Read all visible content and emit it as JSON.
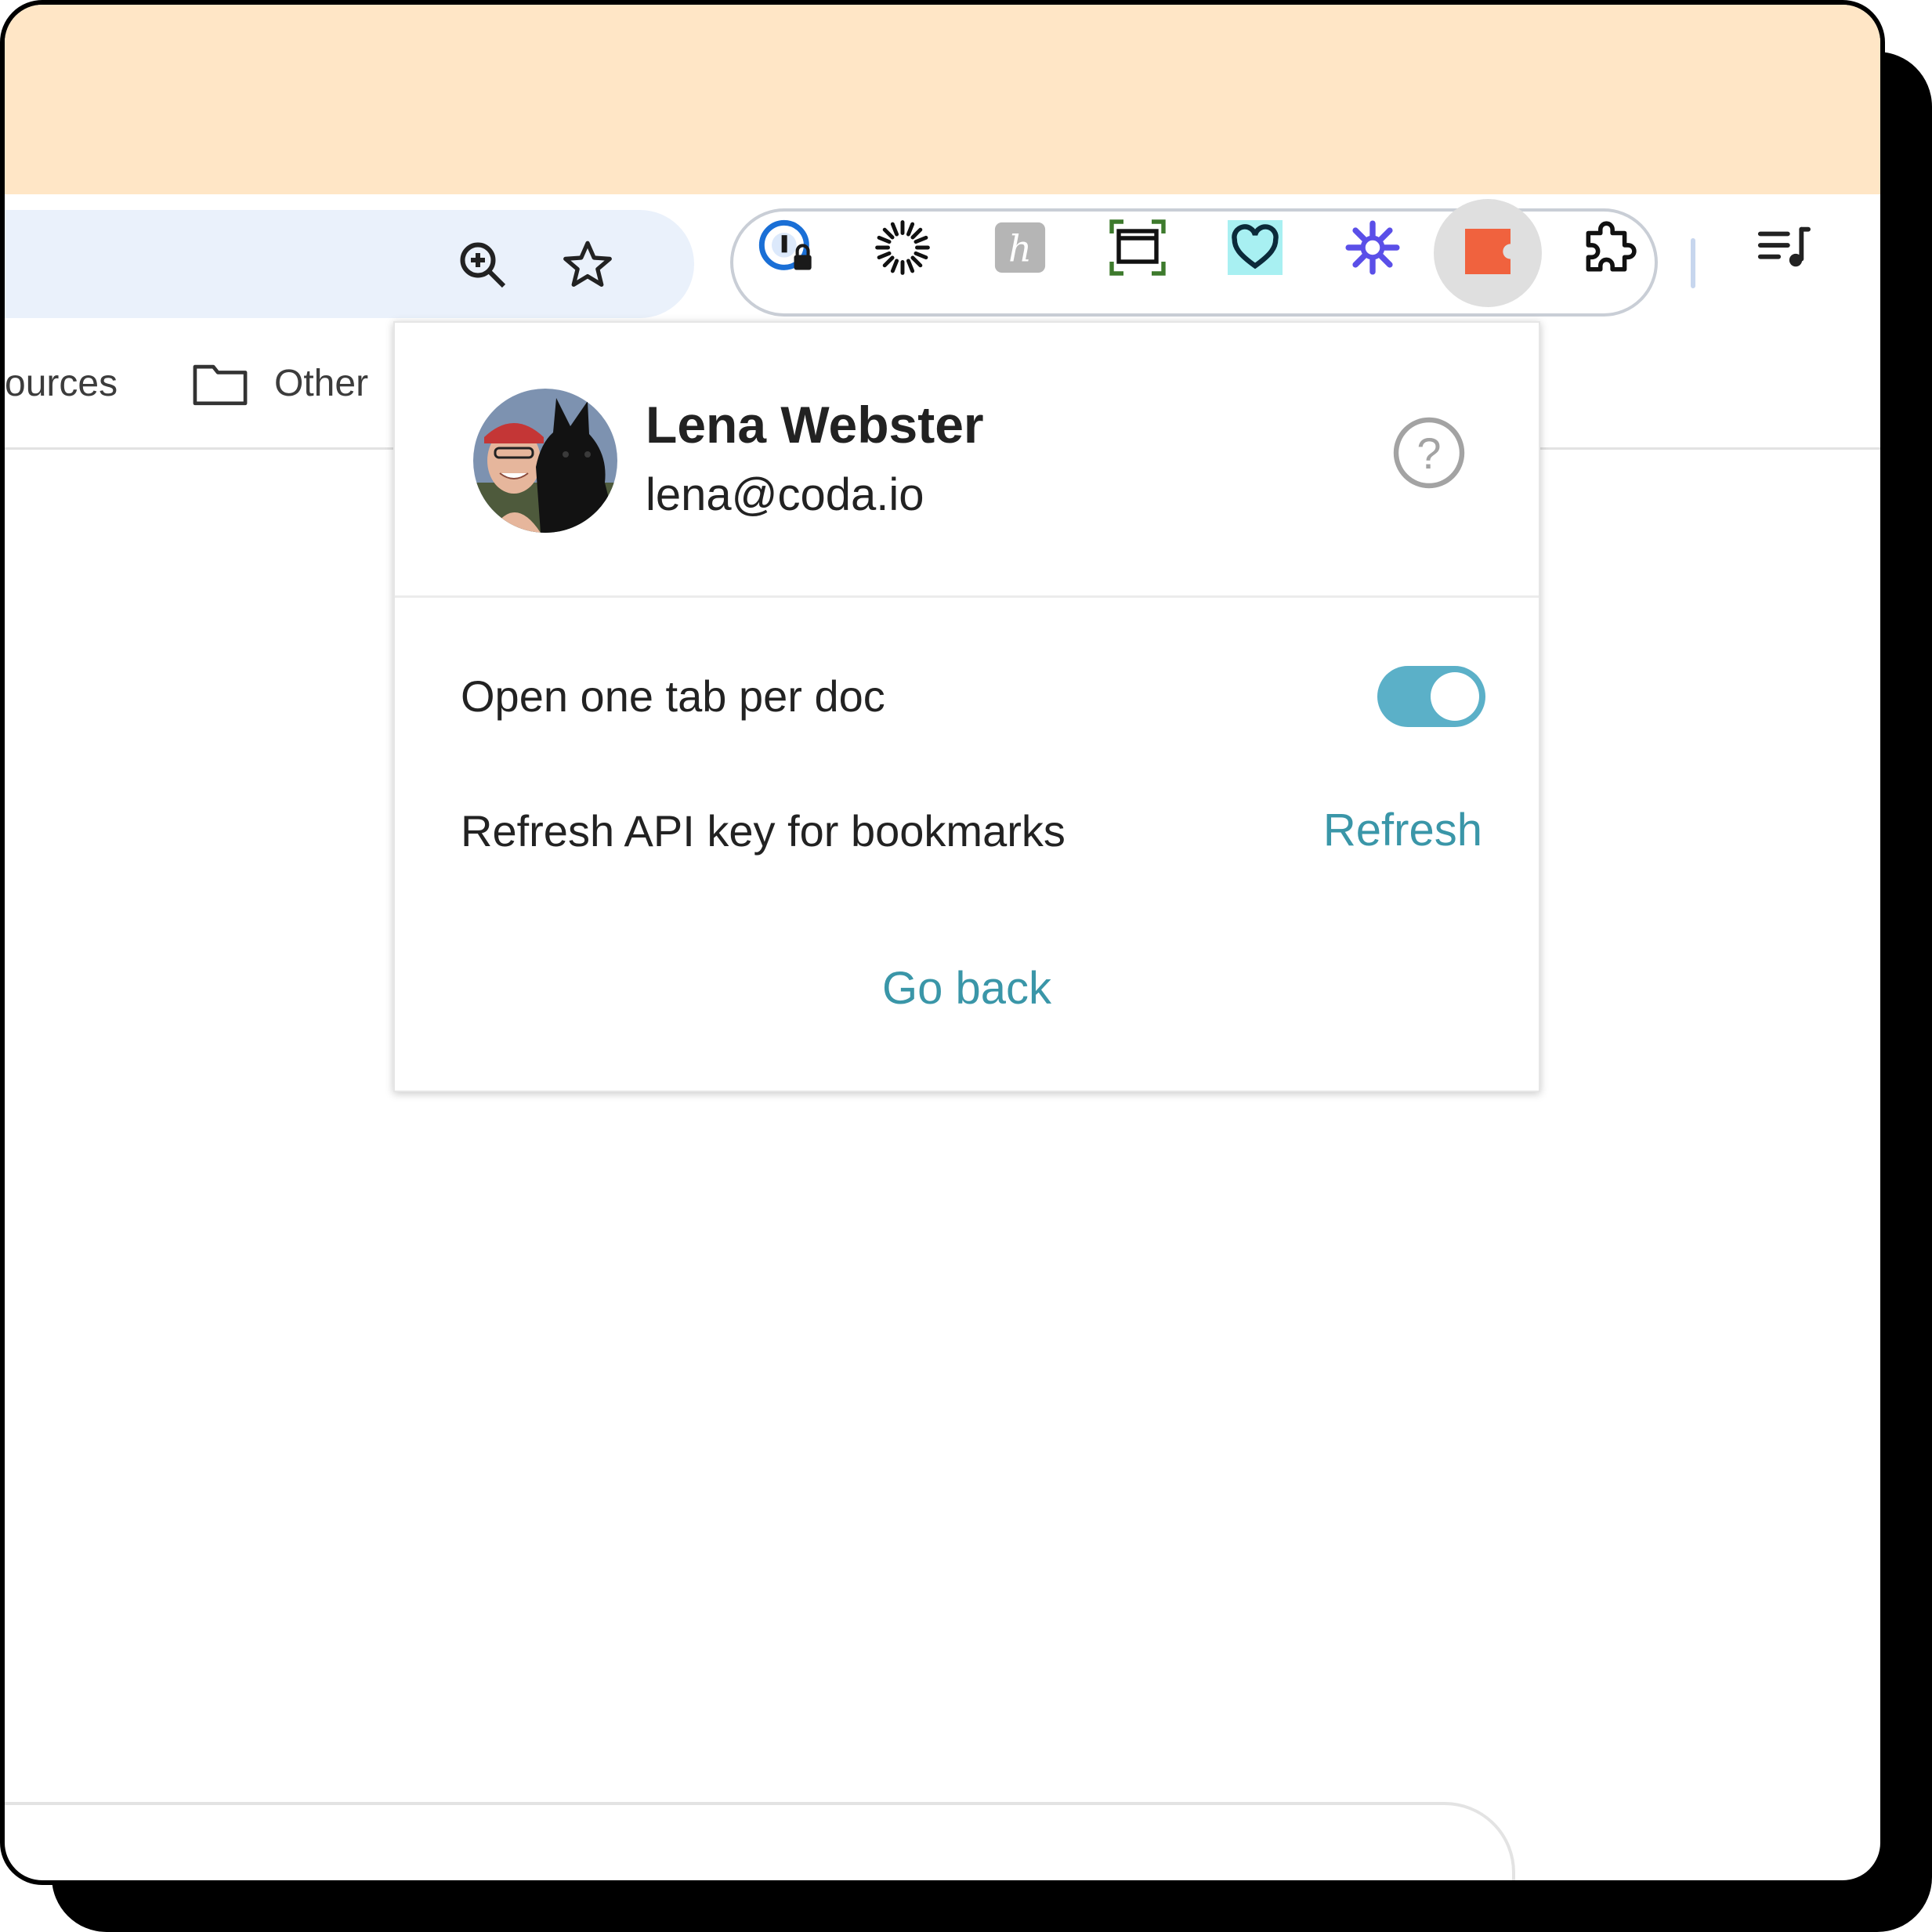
{
  "browser": {
    "toolbar": {
      "omnibox_buttons": [
        {
          "icon": "zoom-in-icon"
        },
        {
          "icon": "star-icon"
        }
      ],
      "extensions": [
        {
          "icon": "password-manager-icon"
        },
        {
          "icon": "sunburst-icon"
        },
        {
          "icon": "honey-h-icon"
        },
        {
          "icon": "screen-capture-icon"
        },
        {
          "icon": "heart-icon"
        },
        {
          "icon": "asterisk-icon"
        },
        {
          "icon": "coda-icon",
          "active": true
        },
        {
          "icon": "puzzle-piece-icon"
        }
      ],
      "media_icon": "media-queue-icon"
    },
    "bookmarks_bar": {
      "items": [
        {
          "label": "ources"
        },
        {
          "label": "Other",
          "icon": "folder-icon"
        }
      ]
    }
  },
  "popup": {
    "user": {
      "name": "Lena Webster",
      "email": "lena@coda.io"
    },
    "help_icon": "help-circle-icon",
    "settings": {
      "open_one_tab_label": "Open one tab per doc",
      "open_one_tab_enabled": true,
      "refresh_api_label": "Refresh API key for bookmarks",
      "refresh_link": "Refresh"
    },
    "go_back_link": "Go back"
  },
  "colors": {
    "titlebar": "#ffe6c6",
    "accent_link": "#3a96a8",
    "toggle_on": "#5bb0c8",
    "coda_orange": "#f0623e"
  }
}
